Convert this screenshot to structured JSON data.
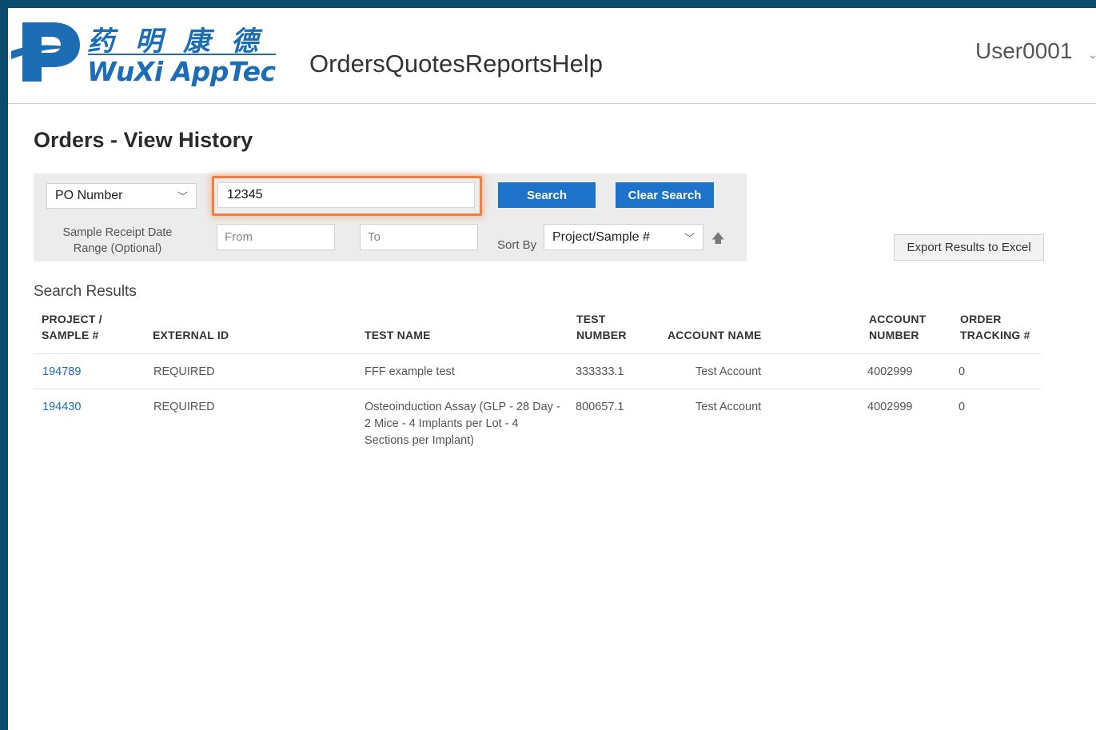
{
  "header": {
    "logo_cn": "药明康德",
    "logo_en": "WuXi AppTec",
    "nav": [
      "Orders",
      "Quotes",
      "Reports",
      "Help"
    ],
    "user": "User0001"
  },
  "page": {
    "title": "Orders - View History"
  },
  "search": {
    "field_selected": "PO Number",
    "po_value": "12345",
    "search_label": "Search",
    "clear_label": "Clear Search",
    "date_label_1": "Sample Receipt Date",
    "date_label_2": "Range (Optional)",
    "from_placeholder": "From",
    "to_placeholder": "To",
    "sortby_label": "Sort By",
    "sort_selected": "Project/Sample #",
    "export_label": "Export Results to Excel"
  },
  "results": {
    "heading": "Search Results",
    "columns": {
      "project_1": "PROJECT /",
      "project_2": "SAMPLE #",
      "external_id": "EXTERNAL ID",
      "test_name": "TEST NAME",
      "test_number_1": "TEST",
      "test_number_2": "NUMBER",
      "account_name": "ACCOUNT NAME",
      "account_number_1": "ACCOUNT",
      "account_number_2": "NUMBER",
      "order_tracking_1": "ORDER",
      "order_tracking_2": "TRACKING #"
    },
    "rows": [
      {
        "project": "194789",
        "external_id": "REQUIRED",
        "test_name_1": "FFF example test",
        "test_name_2": "",
        "test_name_3": "",
        "test_number": "333333.1",
        "account_name": "Test Account",
        "account_number": "4002999",
        "order_tracking": "0"
      },
      {
        "project": "194430",
        "external_id": "REQUIRED",
        "test_name_1": "Osteoinduction Assay (GLP - 28 Day -",
        "test_name_2": "2 Mice - 4 Implants per Lot - 4",
        "test_name_3": "Sections per Implant)",
        "test_number": "800657.1",
        "account_name": "Test Account",
        "account_number": "4002999",
        "order_tracking": "0"
      }
    ]
  },
  "colors": {
    "brand": "#1d6db4",
    "primary_button": "#1d73c9",
    "highlight": "#f27f3d",
    "frame": "#0b4a6f"
  }
}
